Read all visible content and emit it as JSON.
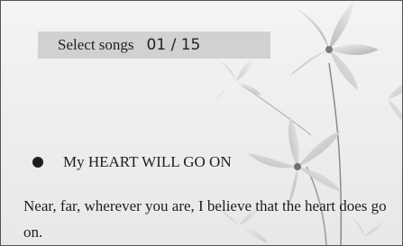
{
  "header": {
    "label": "Select songs",
    "counter": "01 / 15"
  },
  "song": {
    "title": "My HEART WILL GO ON"
  },
  "lyrics": {
    "text": "Near, far, wherever you are, I believe that the heart does go on."
  },
  "background": {
    "image": "clematis-flowers-illustration"
  }
}
